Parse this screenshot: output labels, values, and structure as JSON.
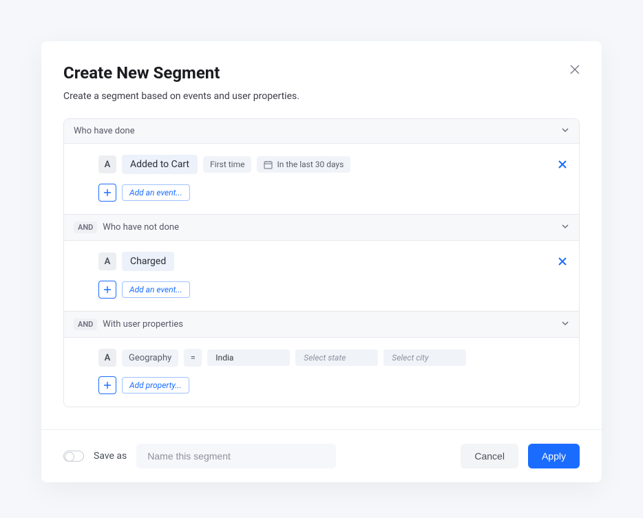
{
  "modal": {
    "title": "Create New Segment",
    "subtitle": "Create a segment based on events and user properties."
  },
  "sections": {
    "done": {
      "header": "Who have done",
      "item_letter": "A",
      "event": "Added to Cart",
      "qualifier": "First time",
      "timeframe": "In the last 30 days",
      "add_label": "Add an event..."
    },
    "not_done": {
      "and": "AND",
      "header": "Who have not done",
      "item_letter": "A",
      "event": "Charged",
      "add_label": "Add an event..."
    },
    "props": {
      "and": "AND",
      "header": "With user properties",
      "item_letter": "A",
      "property": "Geography",
      "operator": "=",
      "value": "India",
      "state_ph": "Select state",
      "city_ph": "Select city",
      "add_label": "Add property..."
    }
  },
  "footer": {
    "save_as_label": "Save as",
    "name_placeholder": "Name this segment",
    "cancel": "Cancel",
    "apply": "Apply"
  }
}
